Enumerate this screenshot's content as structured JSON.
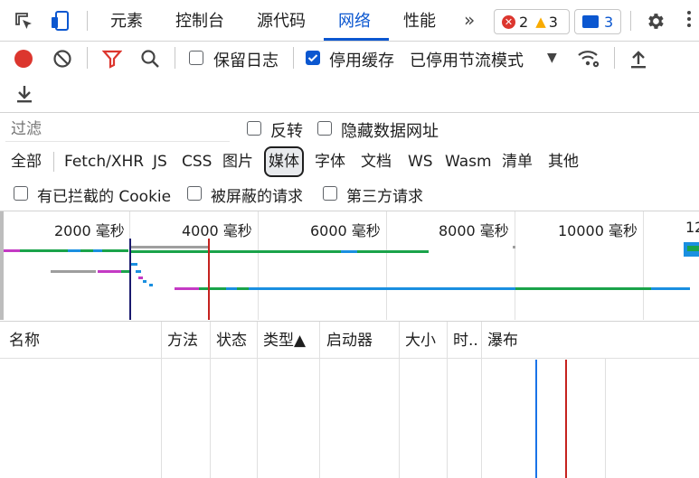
{
  "toolbar": {
    "tabs": [
      "元素",
      "控制台",
      "源代码",
      "网络",
      "性能"
    ],
    "active_tab": "网络",
    "errors": "2",
    "warnings": "3",
    "messages": "3"
  },
  "network_toolbar": {
    "preserve_log": "保留日志",
    "disable_cache": "停用缓存",
    "throttling": "已停用节流模式"
  },
  "filter": {
    "placeholder": "过滤",
    "invert": "反转",
    "hide_data_urls": "隐藏数据网址",
    "types": [
      "全部",
      "Fetch/XHR",
      "JS",
      "CSS",
      "图片",
      "媒体",
      "字体",
      "文档",
      "WS",
      "Wasm",
      "清单",
      "其他"
    ],
    "selected_type": "媒体",
    "blocked_cookies": "有已拦截的 Cookie",
    "blocked_requests": "被屏蔽的请求",
    "third_party": "第三方请求"
  },
  "timeline": {
    "ticks": [
      "2000 毫秒",
      "4000 毫秒",
      "6000 毫秒",
      "8000 毫秒",
      "10000 毫秒",
      "12"
    ]
  },
  "table": {
    "columns": [
      "名称",
      "方法",
      "状态",
      "类型▲",
      "启动器",
      "大小",
      "时..",
      "瀑布"
    ]
  },
  "colors": {
    "accent": "#0b57d0",
    "record": "#dc362e",
    "dom_content_loaded": "#1a73e8",
    "load": "#c5221f"
  }
}
